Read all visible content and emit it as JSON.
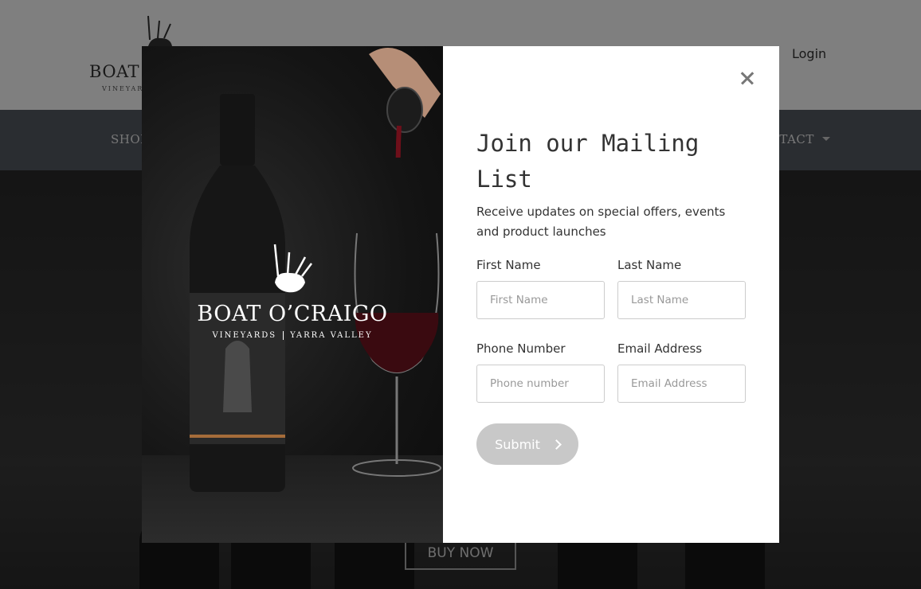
{
  "site": {
    "logo_text": "BOAT",
    "logo_sub": "VINEYARDS",
    "login_label": "Login",
    "nav": [
      {
        "label": "SHOP"
      },
      {
        "label": "CONTACT"
      }
    ],
    "hero_button": "BUY NOW"
  },
  "modal": {
    "brand_name": "BOAT O’CRAIGO",
    "brand_sub_left": "VINEYARDS",
    "brand_sub_right": "YARRA VALLEY",
    "title": "Join our Mailing List",
    "description": "Receive updates on special offers, events and product launches",
    "fields": {
      "first_name": {
        "label": "First Name",
        "placeholder": "First Name"
      },
      "last_name": {
        "label": "Last Name",
        "placeholder": "Last Name"
      },
      "phone": {
        "label": "Phone Number",
        "placeholder": "Phone number"
      },
      "email": {
        "label": "Email Address",
        "placeholder": "Email Address"
      }
    },
    "submit_label": "Submit"
  },
  "colors": {
    "nav_bg": "#555a63",
    "submit_bg": "#c8c8c8",
    "overlay": "rgba(0,0,0,0.5)"
  },
  "icons": [
    "bagpipe-logo-icon",
    "close-icon",
    "chevron-right-icon",
    "caret-down-icon"
  ]
}
